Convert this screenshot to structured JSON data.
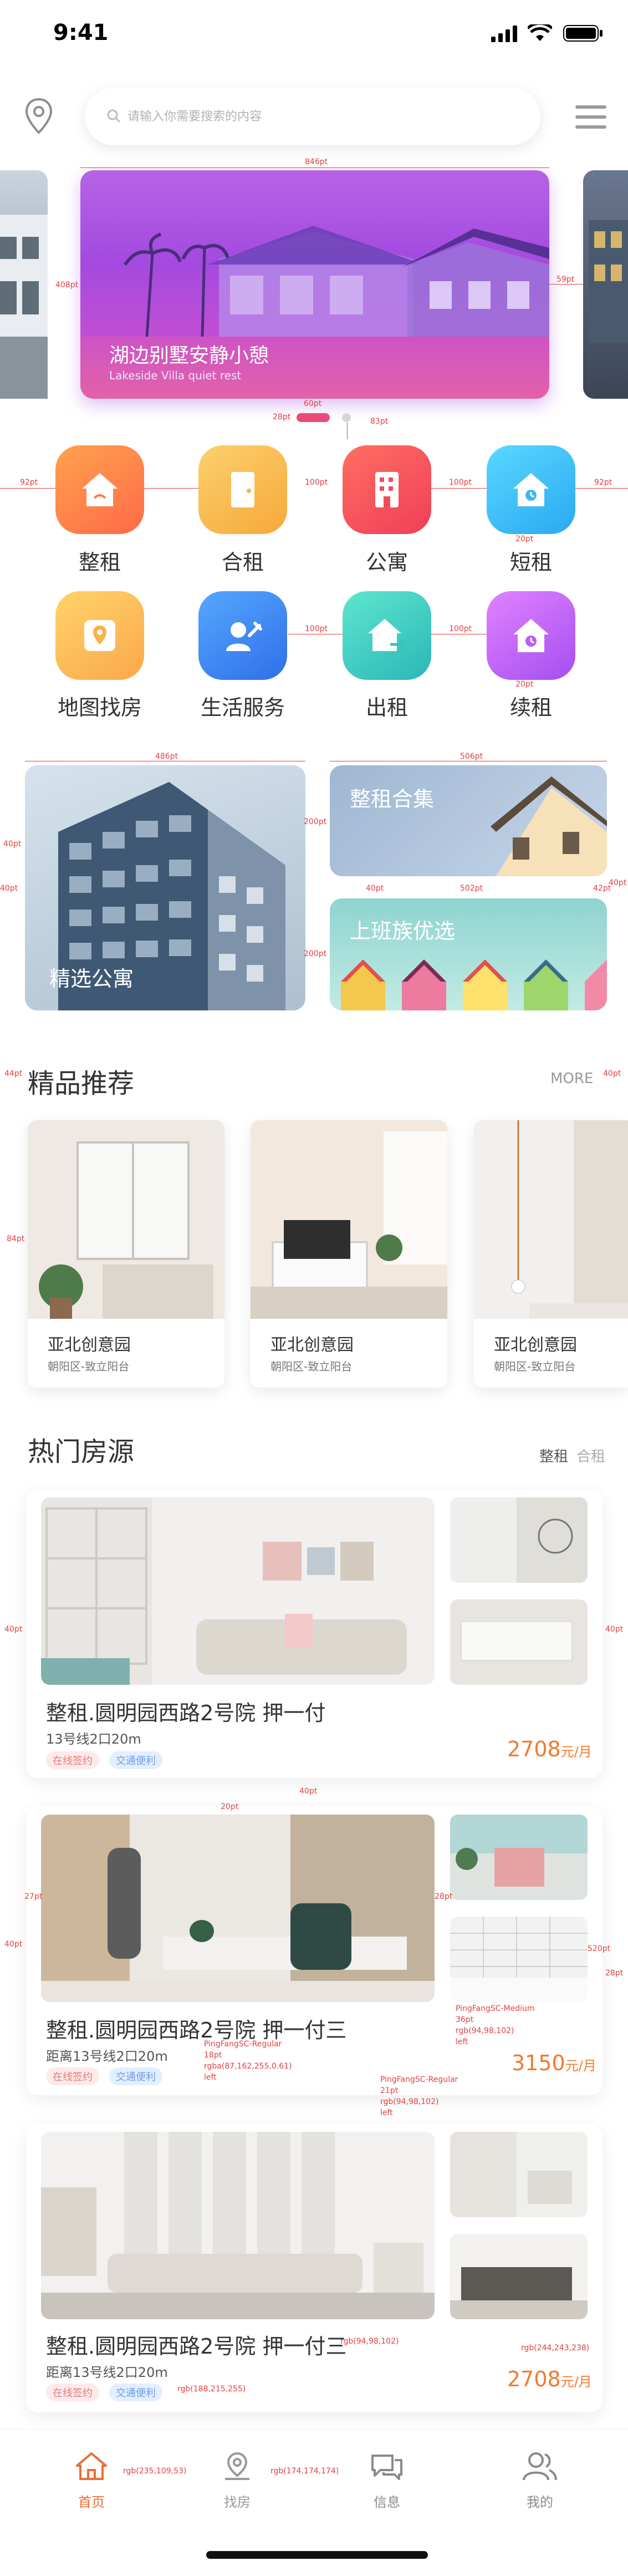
{
  "status": {
    "time": "9:41"
  },
  "search": {
    "placeholder": "请输入你需要搜索的内容"
  },
  "banner": {
    "title": "湖边别墅安静小憩",
    "subtitle": "Lakeside Villa quiet rest"
  },
  "categories": [
    {
      "label": "整租",
      "icon": "house-icon",
      "color": "#ff8a4c"
    },
    {
      "label": "合租",
      "icon": "door-icon",
      "color": "#f6b647"
    },
    {
      "label": "公寓",
      "icon": "building-icon",
      "color": "#f3545c"
    },
    {
      "label": "短租",
      "icon": "house-clock-icon",
      "color": "#3ec2f6"
    },
    {
      "label": "地图找房",
      "icon": "map-pin-icon",
      "color": "#fcbb4b"
    },
    {
      "label": "生活服务",
      "icon": "wrench-user-icon",
      "color": "#3c8ef4"
    },
    {
      "label": "出租",
      "icon": "house-arrow-icon",
      "color": "#37cdc0"
    },
    {
      "label": "续租",
      "icon": "house-timer-icon",
      "color": "#c466ee"
    }
  ],
  "features": {
    "left": "精选公寓",
    "top_right": "整租合集",
    "bottom_right": "上班族优选"
  },
  "recommend": {
    "title": "精品推荐",
    "more": "MORE",
    "items": [
      {
        "name": "亚北创意园",
        "addr": "朝阳区-致立阳台"
      },
      {
        "name": "亚北创意园",
        "addr": "朝阳区-致立阳台"
      },
      {
        "name": "亚北创意园",
        "addr": "朝阳区-致立阳台"
      }
    ]
  },
  "hot": {
    "title": "热门房源",
    "tabs": [
      "整租",
      "合租"
    ],
    "items": [
      {
        "title": "整租.圆明园西路2号院 押一付",
        "meta": "13号线2口20m",
        "tags": [
          "在线签约",
          "交通便利"
        ],
        "price": "2708",
        "unit": "元/月"
      },
      {
        "title": "整租.圆明园西路2号院 押一付三",
        "meta": "距离13号线2口20m",
        "tags": [
          "在线签约",
          "交通便利"
        ],
        "price": "3150",
        "unit": "元/月"
      },
      {
        "title": "整租.圆明园西路2号院 押一付三",
        "meta": "距离13号线2口20m",
        "tags": [
          "在线签约",
          "交通便利"
        ],
        "price": "2708",
        "unit": "元/月"
      }
    ]
  },
  "annotations": {
    "banner_w": "846pt",
    "banner_h": "408pt",
    "banner_gap": "59pt",
    "dot_w": "60pt",
    "dot_gap": "28pt",
    "dot_bottom": "83pt",
    "cat_left": "92pt",
    "cat_gap": "100pt",
    "cat_right": "92pt",
    "cat_label_gap": "20pt",
    "feat_left_w": "486pt",
    "feat_right_w": "506pt",
    "feat_h": "200pt",
    "feat_vgap": "40pt",
    "feat_right_w2": "502pt",
    "feat_gap": "42pt",
    "feat_edge": "40pt",
    "sec_left": "44pt",
    "sec_right": "40pt",
    "rec_top": "84pt",
    "hot_left": "40pt",
    "hot_right": "40pt",
    "hot_gap": "40pt",
    "hot_inner": "20pt",
    "hot_inner_left": "27pt",
    "hot_inner_right": "28pt",
    "hot_h": "520pt",
    "hot_right2": "28pt",
    "spec1": "PingFangSC-Medium",
    "spec1b": "36pt",
    "spec1c": "rgb(94,98,102)",
    "spec1d": "left",
    "spec2": "PingFangSC-Regular",
    "spec2b": "18pt",
    "spec2c": "rgba(87,162,255,0.61)",
    "spec2d": "left",
    "spec3": "PingFangSC-Regular",
    "spec3b": "21pt",
    "spec3c": "rgb(94,98,102)",
    "spec3d": "left",
    "spec4": "rgb(94,98,102)",
    "spec5": "rgb(188,215,255)",
    "spec6": "rgb(244,243,238)",
    "tab_home_color": "rgb(235,109,53)",
    "tab_find_color": "rgb(174,174,174)"
  },
  "tabbar": {
    "items": [
      {
        "label": "首页",
        "icon": "home-icon",
        "active": true
      },
      {
        "label": "找房",
        "icon": "location-icon",
        "active": false
      },
      {
        "label": "信息",
        "icon": "chat-icon",
        "active": false
      },
      {
        "label": "我的",
        "icon": "user-icon",
        "active": false
      }
    ]
  },
  "colors": {
    "accent": "#eb6d35",
    "banner": "#a34ae0",
    "price": "#f07a2e"
  }
}
